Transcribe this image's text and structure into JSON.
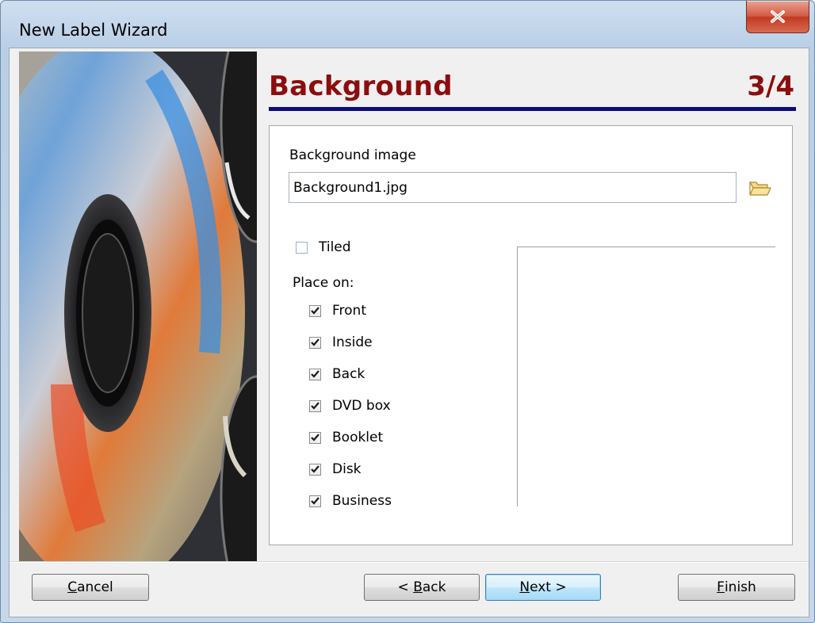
{
  "window": {
    "title": "New Label Wizard",
    "close_symbol": "X"
  },
  "header": {
    "title": "Background",
    "step": "3/4"
  },
  "background_image": {
    "label": "Background image",
    "value": "Background1.jpg",
    "browse_icon": "folder-open-icon"
  },
  "tiled": {
    "label": "Tiled",
    "checked": false
  },
  "place_on": {
    "label": "Place on:",
    "items": [
      {
        "label": "Front",
        "checked": true
      },
      {
        "label": "Inside",
        "checked": true
      },
      {
        "label": "Back",
        "checked": true
      },
      {
        "label": "DVD box",
        "checked": true
      },
      {
        "label": "Booklet",
        "checked": true
      },
      {
        "label": "Disk",
        "checked": true
      },
      {
        "label": "Business",
        "checked": true
      }
    ]
  },
  "buttons": {
    "cancel": {
      "pre": "",
      "accel": "C",
      "post": "ancel"
    },
    "back": {
      "pre": "< ",
      "accel": "B",
      "post": "ack"
    },
    "next": {
      "pre": "",
      "accel": "N",
      "post": "ext >"
    },
    "finish": {
      "pre": "",
      "accel": "F",
      "post": "inish"
    }
  },
  "colors": {
    "header_text": "#8c0d0d",
    "header_rule": "#0c0c7e",
    "close_button": "#c9422b"
  }
}
